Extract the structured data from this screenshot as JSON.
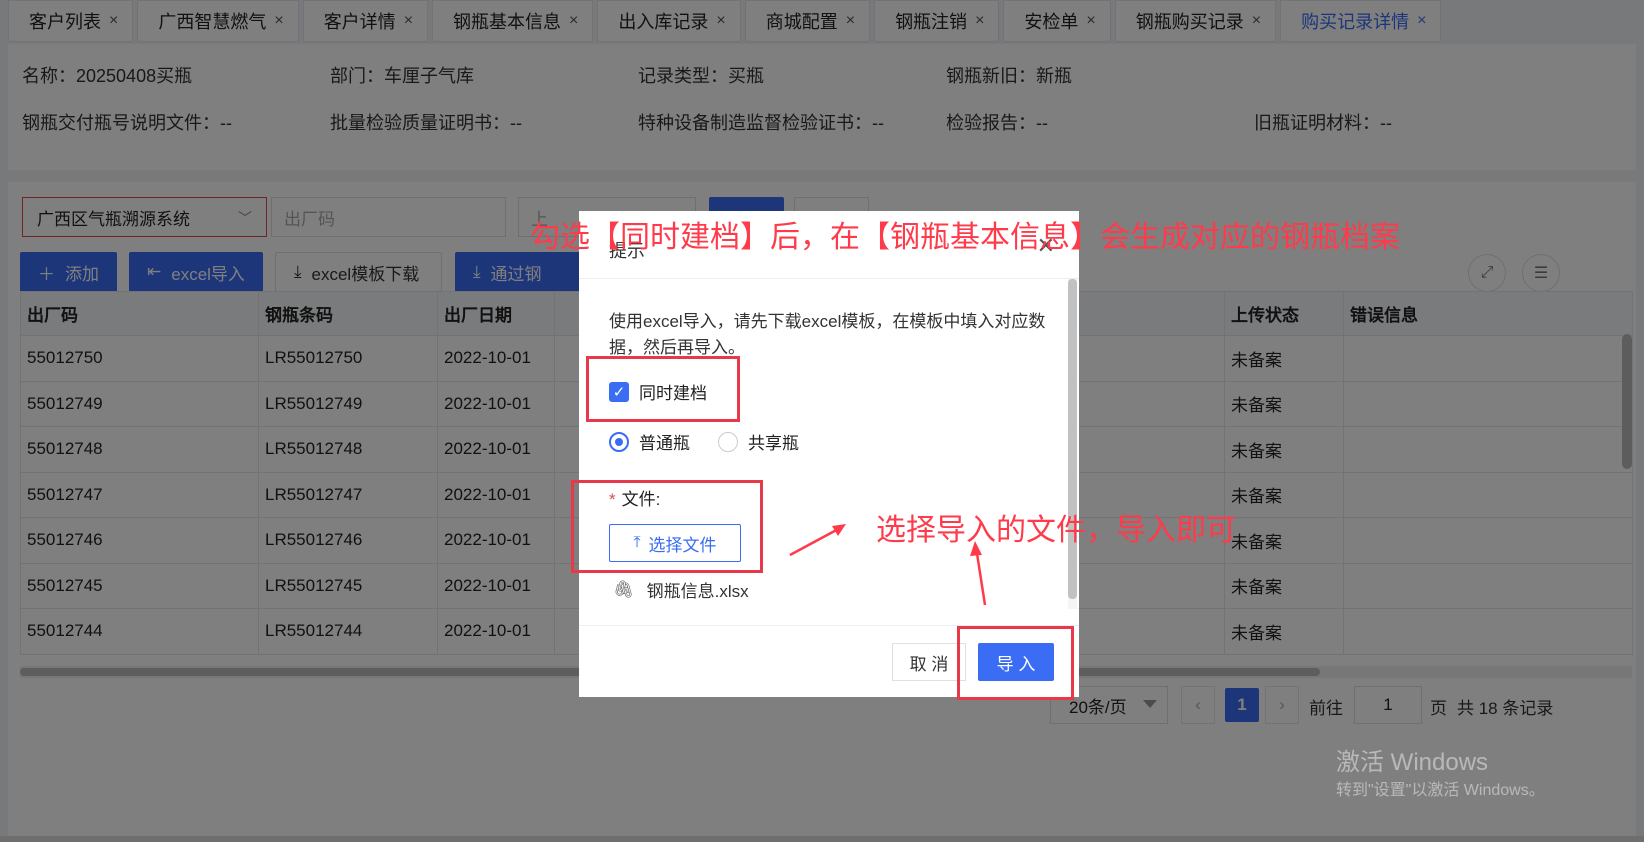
{
  "tabs": [
    {
      "label": "客户列表",
      "active": false
    },
    {
      "label": "广西智慧燃气",
      "active": false
    },
    {
      "label": "客户详情",
      "active": false
    },
    {
      "label": "钢瓶基本信息",
      "active": false
    },
    {
      "label": "出入库记录",
      "active": false
    },
    {
      "label": "商城配置",
      "active": false
    },
    {
      "label": "钢瓶注销",
      "active": false
    },
    {
      "label": "安检单",
      "active": false
    },
    {
      "label": "钢瓶购买记录",
      "active": false
    },
    {
      "label": "购买记录详情",
      "active": true
    }
  ],
  "tab_close": "×",
  "info": {
    "name": "名称：20250408买瓶",
    "dept": "部门：车厘子气库",
    "record_type": "记录类型：买瓶",
    "new_old": "钢瓶新旧：新瓶",
    "delivery_doc": "钢瓶交付瓶号说明文件：--",
    "batch_cert": "批量检验质量证明书：--",
    "special_cert": "特种设备制造监督检验证书：--",
    "inspect_report": "检验报告：--",
    "old_proof": "旧瓶证明材料：--"
  },
  "filters": {
    "system_select": "广西区气瓶溯源系统",
    "factory_code_placeholder": "出厂码",
    "third_placeholder": "上"
  },
  "toolbar": {
    "add": "添加",
    "excel_import": "excel导入",
    "template_download": "excel模板下载",
    "via_cylinder": "通过钢"
  },
  "table": {
    "columns": [
      "出厂码",
      "钢瓶条码",
      "出厂日期",
      "",
      "",
      "上传状态",
      "错误信息"
    ],
    "rows": [
      [
        "55012750",
        "LR55012750",
        "2022-10-01",
        "",
        "",
        "未备案",
        ""
      ],
      [
        "55012749",
        "LR55012749",
        "2022-10-01",
        "",
        "",
        "未备案",
        ""
      ],
      [
        "55012748",
        "LR55012748",
        "2022-10-01",
        "",
        "",
        "未备案",
        ""
      ],
      [
        "55012747",
        "LR55012747",
        "2022-10-01",
        "",
        "",
        "未备案",
        ""
      ],
      [
        "55012746",
        "LR55012746",
        "2022-10-01",
        "",
        "",
        "未备案",
        ""
      ],
      [
        "55012745",
        "LR55012745",
        "2022-10-01",
        "",
        "",
        "未备案",
        ""
      ],
      [
        "55012744",
        "LR55012744",
        "2022-10-01",
        "",
        "",
        "未备案",
        ""
      ]
    ]
  },
  "pager": {
    "page_size": "20条/页",
    "current": "1",
    "goto_label": "前往",
    "goto_value": "1",
    "page_unit": "页",
    "total": "共 18 条记录"
  },
  "dialog": {
    "title": "提示",
    "description": "使用excel导入，请先下载excel模板，在模板中填入对应数据，然后再导入。",
    "checkbox_label": "同时建档",
    "checkbox_checked": true,
    "radio_normal": "普通瓶",
    "radio_shared": "共享瓶",
    "file_label": "文件:",
    "required_mark": "*",
    "upload_button": "选择文件",
    "file_name": "钢瓶信息.xlsx",
    "cancel": "取 消",
    "confirm": "导 入"
  },
  "annotations": {
    "top": "勾选【同时建档】后，在【钢瓶基本信息】会生成对应的钢瓶档案",
    "right": "选择导入的文件，导入即可"
  },
  "watermark": {
    "line1": "激活 Windows",
    "line2": "转到\"设置\"以激活 Windows。"
  },
  "colors": {
    "primary": "#3a6cf4",
    "annotation": "#ff3b4b",
    "highlight_box": "#e8394a"
  }
}
